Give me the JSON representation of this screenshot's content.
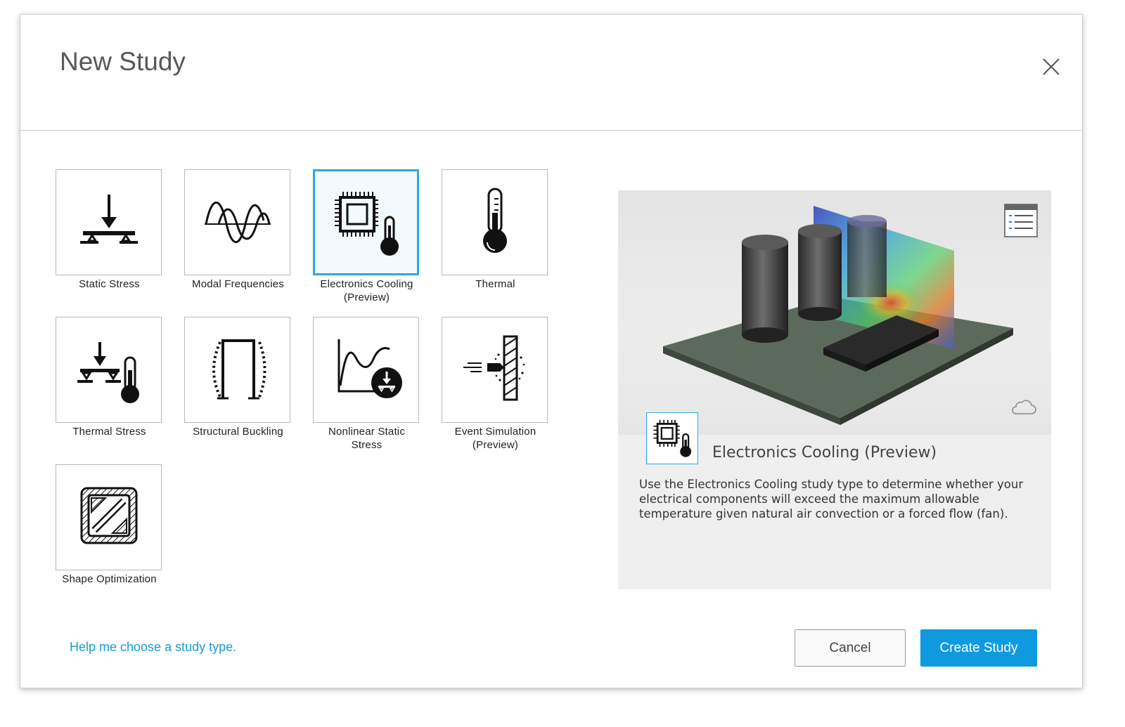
{
  "dialog": {
    "title": "New Study"
  },
  "studies": [
    {
      "id": "static-stress",
      "label": "Static Stress",
      "icon": "static-stress-icon"
    },
    {
      "id": "modal-frequencies",
      "label": "Modal Frequencies",
      "icon": "modal-frequencies-icon"
    },
    {
      "id": "electronics-cooling",
      "label": "Electronics Cooling\n(Preview)",
      "icon": "electronics-cooling-icon",
      "selected": true
    },
    {
      "id": "thermal",
      "label": "Thermal",
      "icon": "thermometer-icon"
    },
    {
      "id": "thermal-stress",
      "label": "Thermal Stress",
      "icon": "thermal-stress-icon"
    },
    {
      "id": "structural-buckling",
      "label": "Structural Buckling",
      "icon": "structural-buckling-icon"
    },
    {
      "id": "nonlinear-static-stress",
      "label": "Nonlinear Static\nStress",
      "icon": "nonlinear-static-stress-icon"
    },
    {
      "id": "event-simulation",
      "label": "Event Simulation\n(Preview)",
      "icon": "event-simulation-icon"
    },
    {
      "id": "shape-optimization",
      "label": "Shape Optimization",
      "icon": "shape-optimization-icon"
    }
  ],
  "preview": {
    "title": "Electronics Cooling (Preview)",
    "description": "Use the Electronics Cooling study type to determine whether your electrical components will exceed the maximum allowable temperature given natural air convection or a forced flow (fan).",
    "icons": [
      "list-icon",
      "cloud-icon"
    ]
  },
  "footer": {
    "help_link": "Help me choose a study type.",
    "cancel_label": "Cancel",
    "create_label": "Create Study"
  },
  "colors": {
    "accent": "#0f9ae0",
    "selection_border": "#2ea7df",
    "link": "#1a9ad6"
  }
}
